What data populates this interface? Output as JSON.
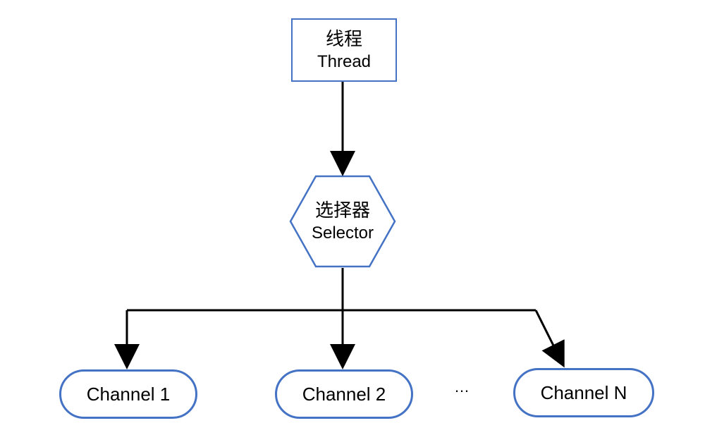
{
  "thread": {
    "cn": "线程",
    "en": "Thread"
  },
  "selector": {
    "cn": "选择器",
    "en": "Selector"
  },
  "channels": {
    "c1": "Channel 1",
    "c2": "Channel 2",
    "cn": "Channel N",
    "ellipsis": "…"
  },
  "colors": {
    "border": "#4472C4",
    "text": "#000000"
  }
}
